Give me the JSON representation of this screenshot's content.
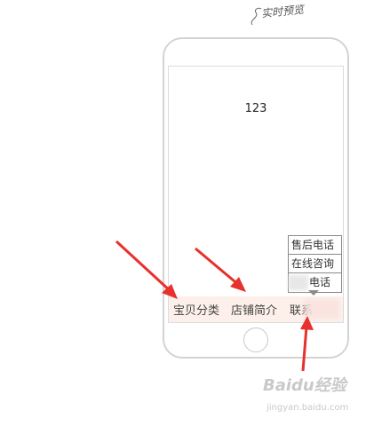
{
  "annotation": {
    "preview_note": "实时预览"
  },
  "phone": {
    "screen_text": "123"
  },
  "menu_bar": {
    "items": [
      {
        "label": "宝贝分类"
      },
      {
        "label": "店铺简介"
      },
      {
        "label": "联系"
      }
    ],
    "background": "#fdf0ea"
  },
  "submenu": {
    "items": [
      {
        "label": "售后电话"
      },
      {
        "label": "在线咨询"
      },
      {
        "label": "电话"
      }
    ]
  },
  "arrow_color": "#e8302c",
  "watermark": {
    "main": "Baidu经验",
    "sub": "jingyan.baidu.com"
  }
}
